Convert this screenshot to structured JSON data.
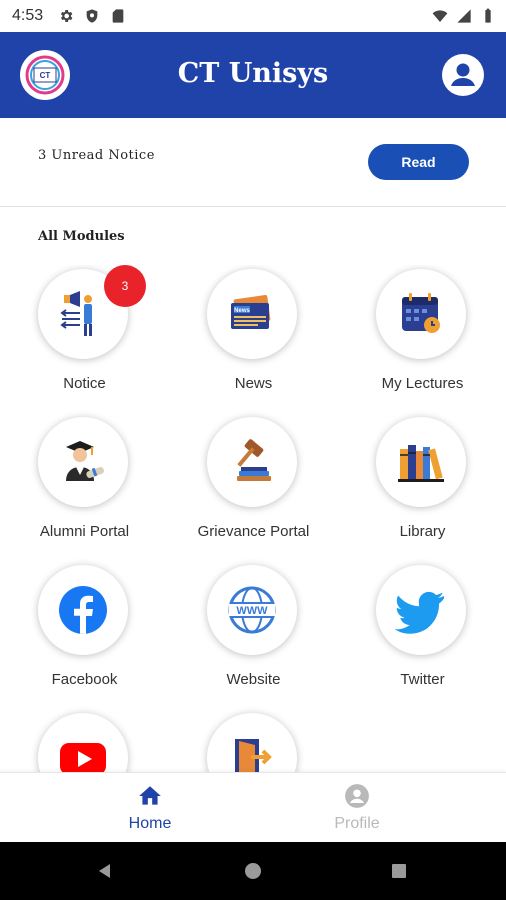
{
  "status_bar": {
    "time": "4:53"
  },
  "app_bar": {
    "title": "CT Unisys",
    "logo_text": "CT"
  },
  "notice": {
    "text": "3 Unread Notice",
    "button_label": "Read"
  },
  "modules_heading": "All Modules",
  "modules": [
    {
      "label": "Notice",
      "icon": "megaphone-icon",
      "badge": "3"
    },
    {
      "label": "News",
      "icon": "newspaper-icon",
      "icon_text": "News"
    },
    {
      "label": "My Lectures",
      "icon": "calendar-icon"
    },
    {
      "label": "Alumni Portal",
      "icon": "graduate-icon"
    },
    {
      "label": "Grievance Portal",
      "icon": "gavel-icon"
    },
    {
      "label": "Library",
      "icon": "books-icon"
    },
    {
      "label": "Facebook",
      "icon": "facebook-icon"
    },
    {
      "label": "Website",
      "icon": "globe-www-icon",
      "icon_text": "WWW"
    },
    {
      "label": "Twitter",
      "icon": "twitter-icon"
    },
    {
      "label": "",
      "icon": "youtube-icon"
    },
    {
      "label": "",
      "icon": "exit-door-icon"
    }
  ],
  "bottom_nav": [
    {
      "label": "Home",
      "icon": "home-icon",
      "active": true
    },
    {
      "label": "Profile",
      "icon": "account-circle-icon",
      "active": false
    }
  ],
  "colors": {
    "primary": "#1f43a8",
    "badge": "#e8232a",
    "read_button": "#1a4fb5"
  }
}
